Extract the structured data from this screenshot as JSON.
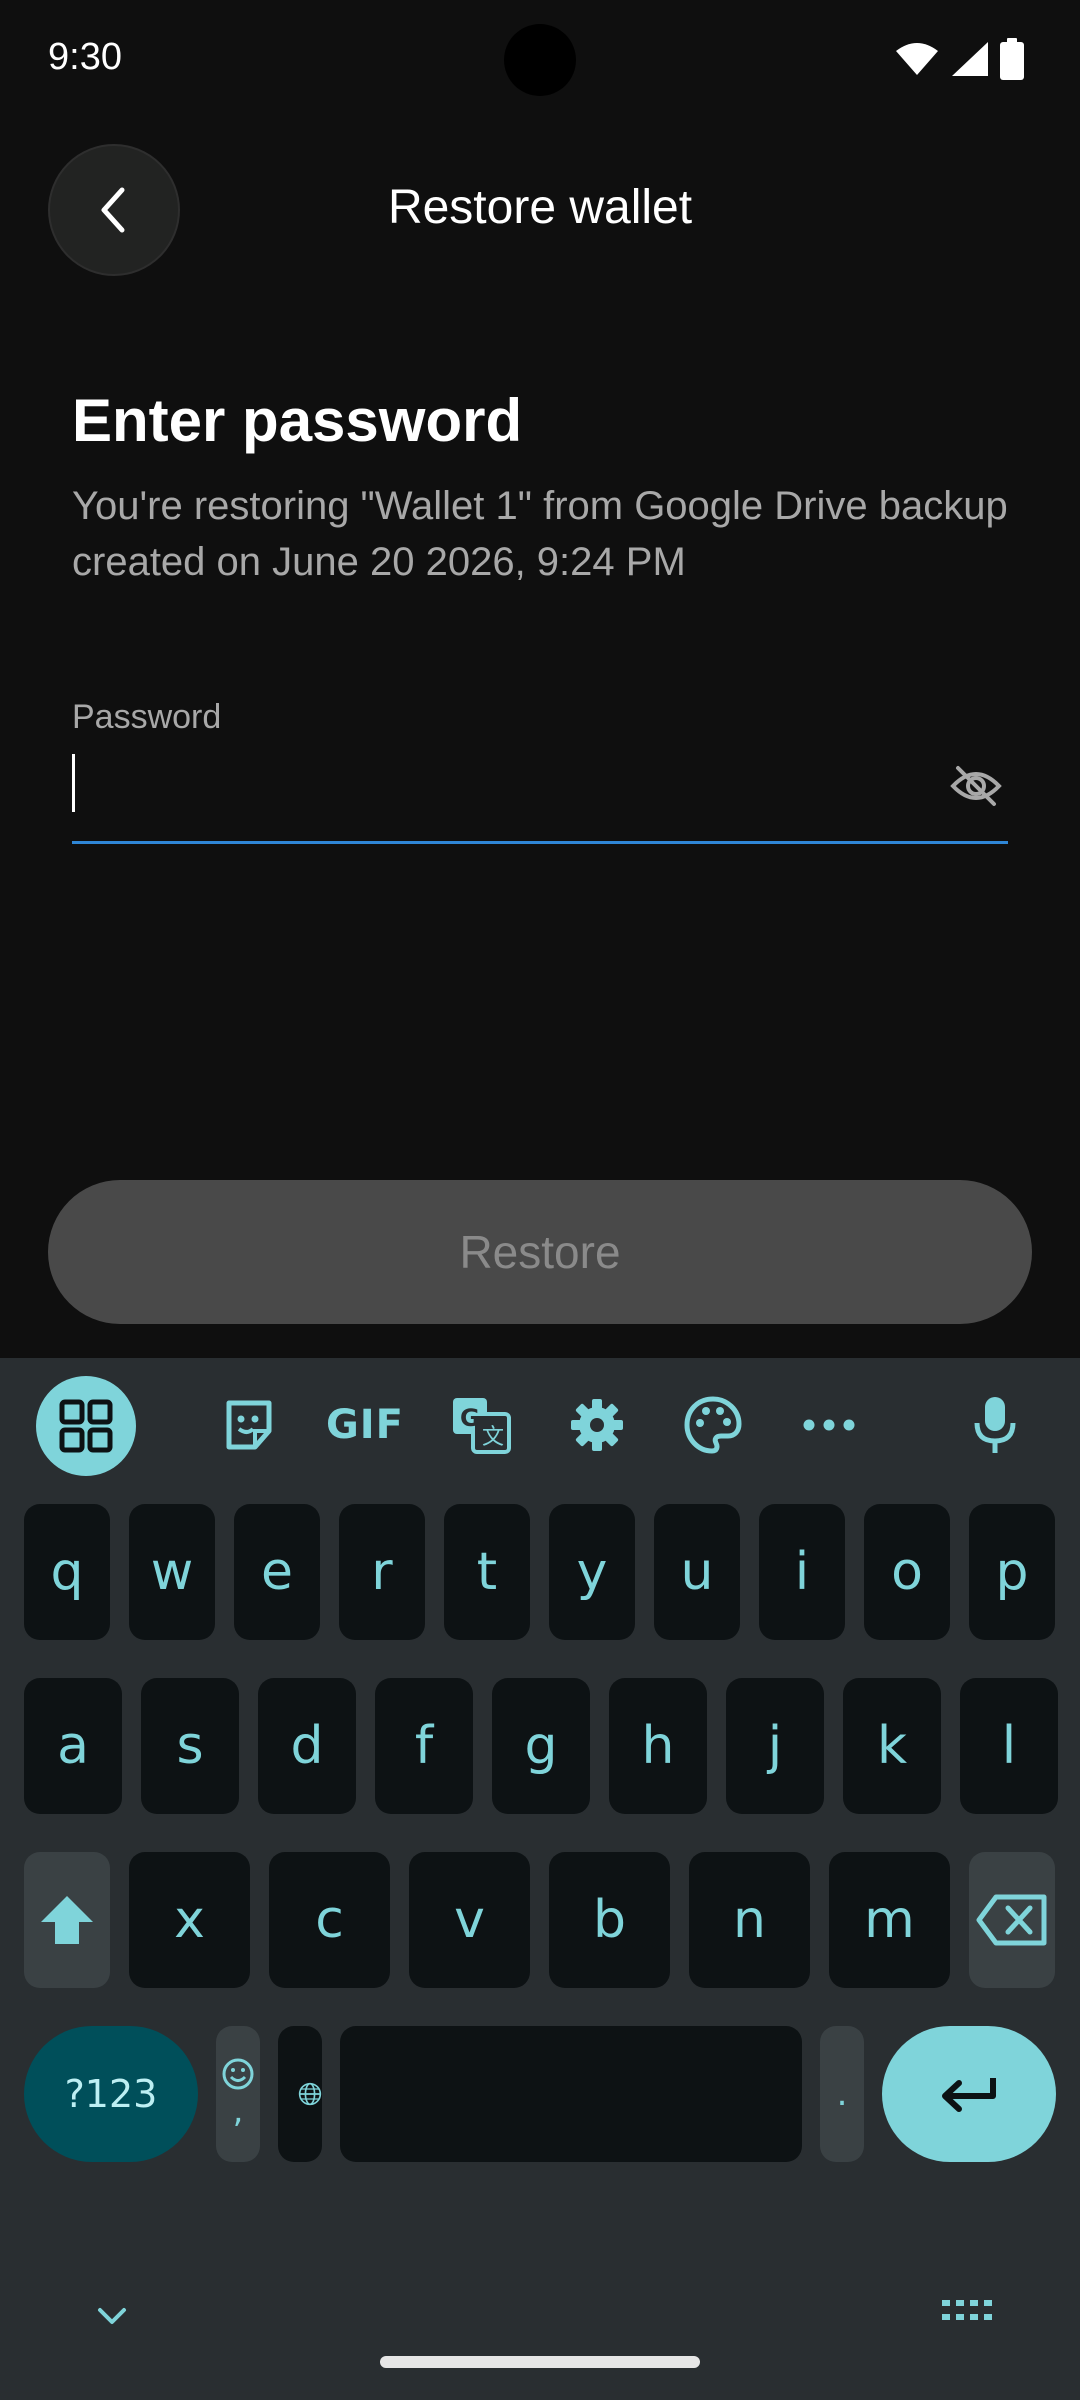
{
  "status": {
    "time": "9:30"
  },
  "header": {
    "title": "Restore wallet"
  },
  "content": {
    "heading": "Enter password",
    "subtitle": "You're restoring \"Wallet 1\" from Google Drive backup created on June 20 2026, 9:24 PM",
    "password_label": "Password",
    "password_value": ""
  },
  "actions": {
    "restore_label": "Restore"
  },
  "keyboard": {
    "toolbar": {
      "gif_label": "GIF"
    },
    "row1": [
      "q",
      "w",
      "e",
      "r",
      "t",
      "y",
      "u",
      "i",
      "o",
      "p"
    ],
    "row2": [
      "a",
      "s",
      "d",
      "f",
      "g",
      "h",
      "j",
      "k",
      "l"
    ],
    "row3": [
      "x",
      "c",
      "v",
      "b",
      "n",
      "m"
    ],
    "symbols_label": "?123",
    "comma_label": ",",
    "period_label": "."
  },
  "colors": {
    "accent": "#7fd4da",
    "focus_line": "#2f86d6",
    "background": "#0f0f0f",
    "keyboard_bg": "#292e31"
  }
}
